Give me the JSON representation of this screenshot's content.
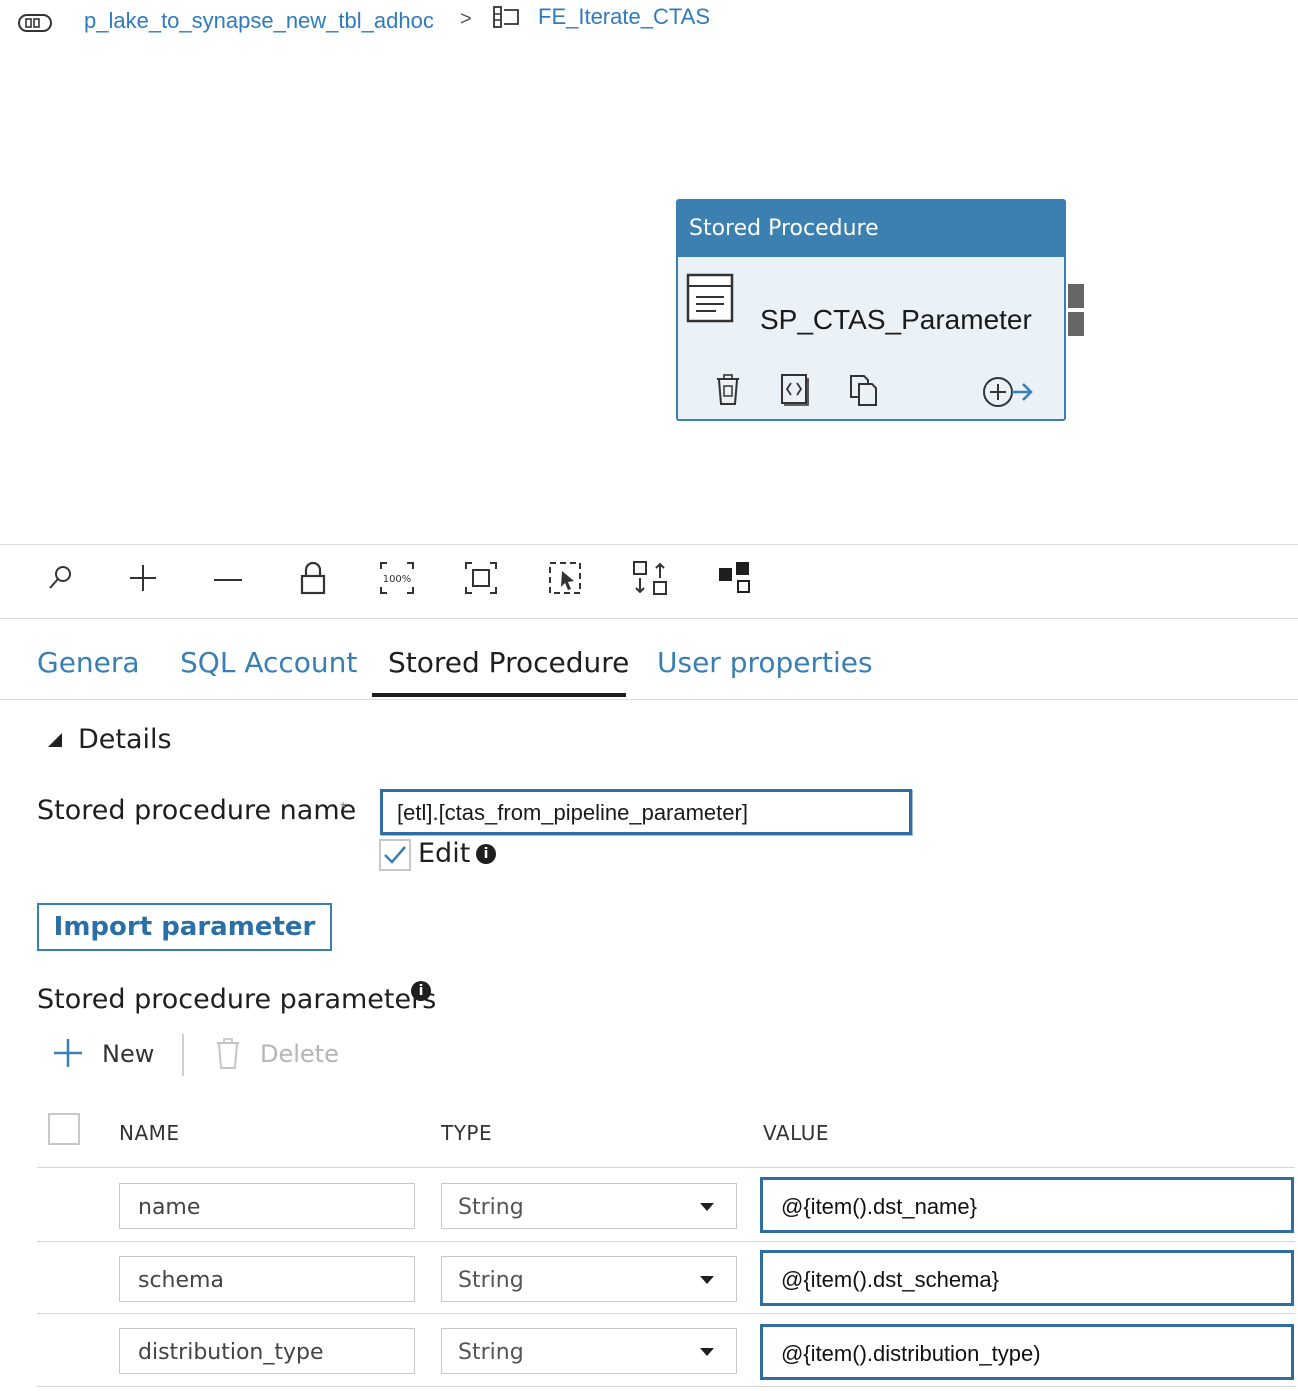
{
  "breadcrumb": {
    "pipeline": "p_lake_to_synapse_new_tbl_adhoc",
    "separator": ">",
    "activity": "FE_Iterate_CTAS"
  },
  "activity_card": {
    "type_label": "Stored Procedure",
    "name": "SP_CTAS_Parameter",
    "header_color": "#3c7fb1"
  },
  "toolbar": {
    "icons": [
      "search-icon",
      "zoom-in-icon",
      "zoom-out-icon",
      "lock-icon",
      "zoom-100-icon",
      "fit-to-screen-icon",
      "select-icon",
      "auto-align-icon",
      "layout-icon"
    ]
  },
  "tabs": [
    {
      "label": "Genera",
      "active": false
    },
    {
      "label": "SQL Account",
      "active": false
    },
    {
      "label": "Stored Procedure",
      "active": true
    },
    {
      "label": "User properties",
      "active": false
    }
  ],
  "details": {
    "section_label": "Details",
    "sp_name_label": "Stored procedure name",
    "sp_name_required": "*",
    "sp_name_value": "[etl].[ctas_from_pipeline_parameter]",
    "edit_label": "Edit",
    "edit_checked": true,
    "import_button": "Import parameter",
    "params_label": "Stored procedure parameters",
    "new_label": "New",
    "delete_label": "Delete"
  },
  "param_table": {
    "headers": {
      "name": "NAME",
      "type": "TYPE",
      "value": "VALUE"
    },
    "rows": [
      {
        "name": "name",
        "type": "String",
        "value": "@{item().dst_name}"
      },
      {
        "name": "schema",
        "type": "String",
        "value": "@{item().dst_schema}"
      },
      {
        "name": "distribution_type",
        "type": "String",
        "value": "@{item().distribution_type)"
      }
    ]
  },
  "colors": {
    "accent": "#3a7fb3",
    "link": "#2f7bbf"
  }
}
